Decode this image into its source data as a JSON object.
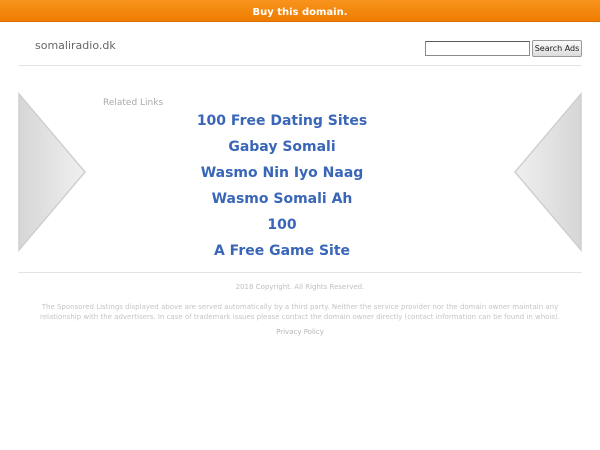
{
  "topbar": {
    "label": "Buy this domain."
  },
  "header": {
    "domain": "somaliradio.dk",
    "search_value": "",
    "search_button": "Search Ads"
  },
  "main": {
    "related_heading": "Related Links",
    "links": [
      "100 Free Dating Sites",
      "Gabay Somali",
      "Wasmo Nin Iyo Naag",
      "Wasmo Somali Ah",
      "100",
      "A Free Game Site"
    ]
  },
  "footer": {
    "copyright": "2018 Copyright. All Rights Reserved.",
    "disclaimer": "The Sponsored Listings displayed above are served automatically by a third party. Neither the service provider nor the domain owner maintain any relationship with the advertisers. In case of trademark issues please contact the domain owner directly (contact information can be found in whois).",
    "privacy": "Privacy Policy"
  },
  "colors": {
    "topbar": "#f7941d",
    "link": "#3a66b8",
    "arrow_fill": "#e6e6e6"
  }
}
